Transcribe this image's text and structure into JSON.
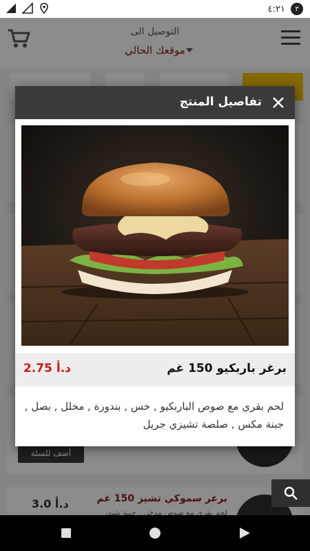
{
  "status_bar": {
    "time": "٤:٢١",
    "badge": "٣"
  },
  "header": {
    "deliver_label": "التوصيل الى",
    "deliver_value": "موقعك الحالي"
  },
  "background_list": {
    "add_to_cart_label": "أضف للسلة",
    "visible_item": {
      "title": "برغر سموكي تشيز 150 غم",
      "description": "لحم بقري مع صوص مدخن , جبنة شيدر",
      "price": "3.0 د.أ"
    }
  },
  "dialog": {
    "title": "تفاصيل المنتج",
    "close_icon": "close-icon",
    "product": {
      "name": "برغر باربكيو 150 غم",
      "price": "2.75 د.أ",
      "description": "لحم بقري مع صوص الباربكيو , خس , بندورة , مخلل , بصل , جبنة مكس , صلصة تشيزي جريل"
    }
  },
  "colors": {
    "accent_yellow": "#f2c200",
    "price_red": "#d01818",
    "brand_maroon": "#8b1b1b",
    "header_dark": "#3a3a3a"
  }
}
